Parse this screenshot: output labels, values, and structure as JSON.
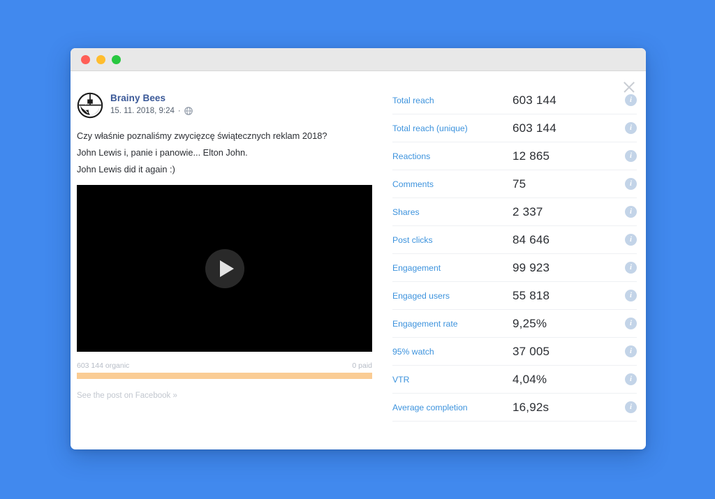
{
  "window": {
    "traffic_lights": [
      "close",
      "minimize",
      "maximize"
    ],
    "close_icon": "close-icon"
  },
  "post": {
    "avatar_icon": "brainy-bees-logo-avatar",
    "page_name": "Brainy Bees",
    "timestamp": "15. 11. 2018, 9:24",
    "separator": "·",
    "privacy_icon": "globe-public-icon",
    "body_lines": [
      "Czy właśnie poznaliśmy zwycięzcę świątecznych reklam 2018?",
      "John Lewis i, panie i panowie... Elton John.",
      "John Lewis did it again :)"
    ],
    "video": {
      "play_icon": "play-icon"
    },
    "reach_bar": {
      "organic_label": "603 144 organic",
      "paid_label": "0 paid",
      "organic_percent": 100
    },
    "facebook_link": "See the post on Facebook »"
  },
  "stats": {
    "info_icon": "info-icon",
    "rows": [
      {
        "label": "Total reach",
        "value": "603 144"
      },
      {
        "label": "Total reach (unique)",
        "value": "603 144"
      },
      {
        "label": "Reactions",
        "value": "12 865"
      },
      {
        "label": "Comments",
        "value": "75"
      },
      {
        "label": "Shares",
        "value": "2 337"
      },
      {
        "label": "Post clicks",
        "value": "84 646"
      },
      {
        "label": "Engagement",
        "value": "99 923"
      },
      {
        "label": "Engaged users",
        "value": "55 818"
      },
      {
        "label": "Engagement rate",
        "value": "9,25%"
      },
      {
        "label": "95% watch",
        "value": "37 005"
      },
      {
        "label": "VTR",
        "value": "4,04%"
      },
      {
        "label": "Average completion",
        "value": "16,92s"
      }
    ]
  },
  "colors": {
    "background": "#4189ee",
    "page_name": "#3b5998",
    "stat_label": "#3d93dd",
    "reach_fill": "#facc94",
    "info_icon": "#c3d4e8"
  }
}
